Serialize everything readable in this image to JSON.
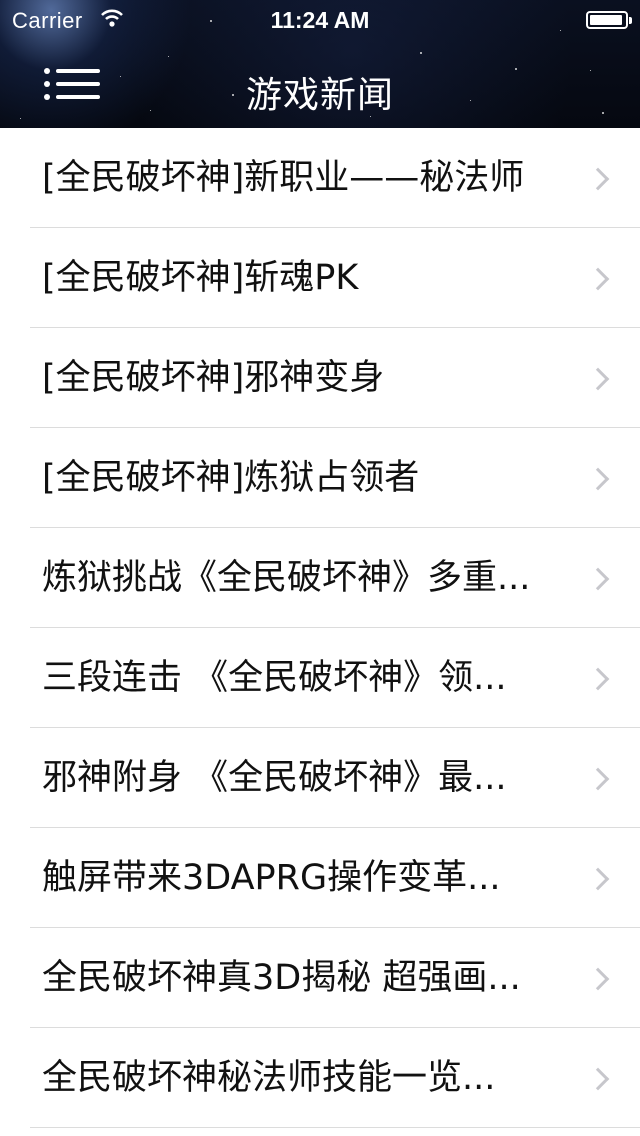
{
  "status_bar": {
    "carrier": "Carrier",
    "time": "11:24 AM",
    "battery_level_fraction": 0.95
  },
  "nav": {
    "title": "游戏新闻",
    "menu_icon": "hamburger-list-icon"
  },
  "news_items": [
    "[全民破坏神]新职业——秘法师",
    "[全民破坏神]斩魂PK",
    "[全民破坏神]邪神变身",
    "[全民破坏神]炼狱占领者",
    "炼狱挑战《全民破坏神》多重...",
    "三段连击 《全民破坏神》领...",
    "邪神附身 《全民破坏神》最...",
    "触屏带来3DAPRG操作变革...",
    "全民破坏神真3D揭秘 超强画...",
    "全民破坏神秘法师技能一览..."
  ],
  "colors": {
    "header_bg": "#0a1020",
    "separator": "#dcdcdc",
    "chevron": "#c7c7cc",
    "text": "#111111"
  }
}
